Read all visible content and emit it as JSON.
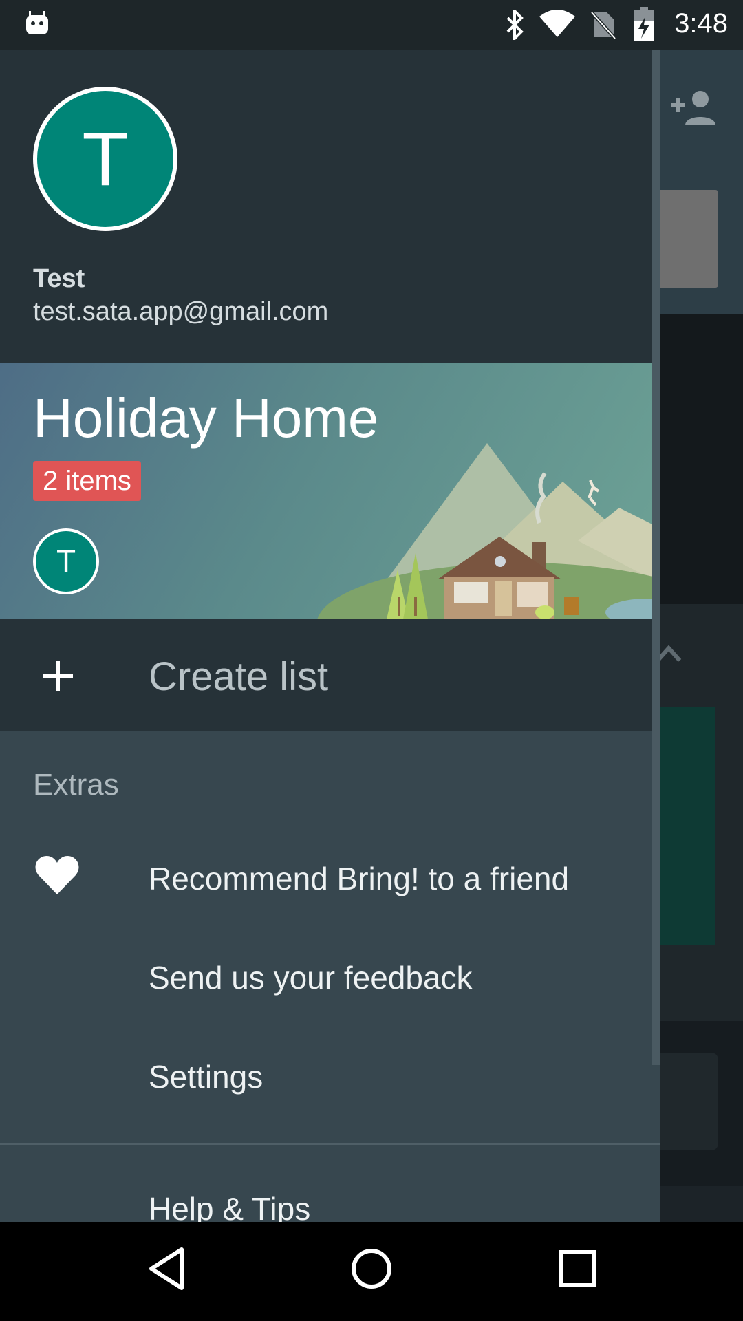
{
  "status_bar": {
    "time": "3:48",
    "icons": [
      "android-icon",
      "bluetooth-icon",
      "wifi-icon",
      "no-sim-icon",
      "battery-charging-icon"
    ]
  },
  "profile": {
    "avatar_letter": "T",
    "name": "Test",
    "email": "test.sata.app@gmail.com"
  },
  "current_list": {
    "title": "Holiday Home",
    "badge": "2 items",
    "member_letter": "T"
  },
  "create_list": {
    "icon": "plus-icon",
    "label": "Create list"
  },
  "extras": {
    "header": "Extras",
    "items": [
      {
        "label": "Recommend Bring! to a friend",
        "icon": "heart-icon"
      },
      {
        "label": "Send us your feedback"
      },
      {
        "label": "Settings"
      }
    ]
  },
  "help": {
    "label": "Help & Tips"
  },
  "nav_bar": {
    "icons": [
      "back-icon",
      "home-icon",
      "recents-icon"
    ]
  },
  "colors": {
    "drawer_bg": "#37474f",
    "header_bg": "#263238",
    "avatar_teal": "#008577",
    "badge_red": "#e05555"
  }
}
